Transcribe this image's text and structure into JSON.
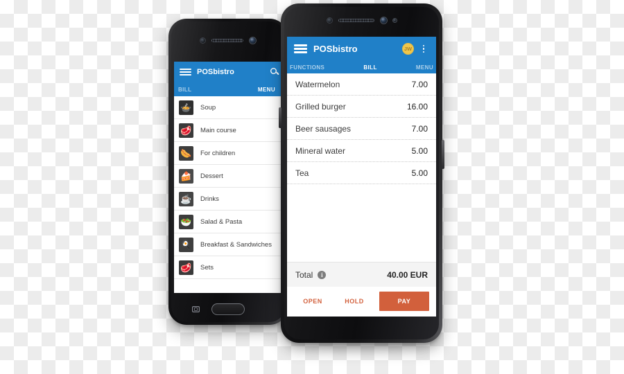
{
  "app": {
    "name": "POSbistro",
    "avatar_initials": "JW",
    "accent_blue": "#2080c8",
    "accent_orange": "#d2603c",
    "avatar_color": "#f0c64b"
  },
  "front_phone": {
    "tabs": [
      {
        "label": "FUNCTIONS",
        "active": false
      },
      {
        "label": "BILL",
        "active": true
      },
      {
        "label": "MENU",
        "active": false
      }
    ],
    "bill_items": [
      {
        "name": "Watermelon",
        "price": "7.00"
      },
      {
        "name": "Grilled burger",
        "price": "16.00"
      },
      {
        "name": "Beer sausages",
        "price": "7.00"
      },
      {
        "name": "Mineral water",
        "price": "5.00"
      },
      {
        "name": "Tea",
        "price": "5.00"
      }
    ],
    "total": {
      "label": "Total",
      "info_icon": "info-icon",
      "value": "40.00 EUR"
    },
    "actions": [
      {
        "label": "OPEN",
        "style": "text"
      },
      {
        "label": "HOLD",
        "style": "text"
      },
      {
        "label": "PAY",
        "style": "filled"
      }
    ]
  },
  "back_phone": {
    "tabs": [
      {
        "label": "BILL",
        "active": false
      },
      {
        "label": "MENU",
        "active": true
      }
    ],
    "search_icon": "search-icon",
    "menu_items": [
      {
        "label": "Soup",
        "icon": "soup-icon",
        "glyph": "🍲",
        "bg": "#2f2f2f"
      },
      {
        "label": "Main course",
        "icon": "main-course-icon",
        "glyph": "🥩",
        "bg": "#3a3a3a"
      },
      {
        "label": "For children",
        "icon": "for-children-icon",
        "glyph": "🌭",
        "bg": "#3d3d3d"
      },
      {
        "label": "Dessert",
        "icon": "dessert-icon",
        "glyph": "🍰",
        "bg": "#4a4a4a"
      },
      {
        "label": "Drinks",
        "icon": "drinks-icon",
        "glyph": "☕",
        "bg": "#454545"
      },
      {
        "label": "Salad & Pasta",
        "icon": "salad-pasta-icon",
        "glyph": "🥗",
        "bg": "#3c3c3c"
      },
      {
        "label": "Breakfast & Sandwiches",
        "icon": "breakfast-sandwiches-icon",
        "glyph": "🍳",
        "bg": "#3f3f3f"
      },
      {
        "label": "Sets",
        "icon": "sets-icon",
        "glyph": "🥩",
        "bg": "#3a3a3a"
      }
    ]
  }
}
